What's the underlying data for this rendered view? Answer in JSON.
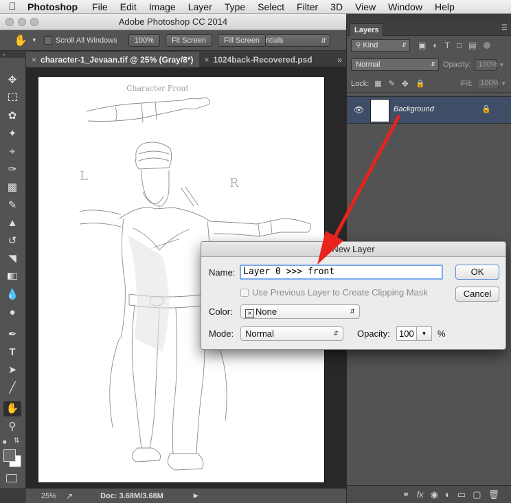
{
  "menubar": {
    "app_name": "Photoshop",
    "items": [
      "File",
      "Edit",
      "Image",
      "Layer",
      "Type",
      "Select",
      "Filter",
      "3D",
      "View",
      "Window",
      "Help"
    ]
  },
  "window": {
    "title": "Adobe Photoshop CC 2014"
  },
  "options_bar": {
    "scroll_all_label": "Scroll All Windows",
    "zoom_100_label": "100%",
    "fit_screen_label": "Fit Screen",
    "fill_screen_label": "Fill Screen",
    "workspace_label": "ntials"
  },
  "tabs": [
    {
      "label": "character-1_Jevaan.tif @ 25% (Gray/8*)",
      "close": "×",
      "active": true
    },
    {
      "label": "1024back-Recovered.psd",
      "close": "×",
      "active": false
    }
  ],
  "tabs_overflow": "»",
  "sketch_texts": {
    "title": "Character  Front",
    "left_mark": "L",
    "right_mark": "R"
  },
  "status": {
    "zoom": "25%",
    "doc": "Doc: 3.68M/3.68M",
    "arrow": "▶"
  },
  "layers_panel": {
    "tab_label": "Layers",
    "filter_label": "Kind",
    "blend_mode": "Normal",
    "opacity_label": "Opacity:",
    "opacity_value": "100%",
    "lock_label": "Lock:",
    "fill_label": "Fill:",
    "fill_value": "100%",
    "layer_name": "Background",
    "footer_icons": [
      "link-icon",
      "fx-icon",
      "mask-icon",
      "adjustment-icon",
      "folder-icon",
      "new-layer-icon",
      "trash-icon"
    ],
    "fx_glyph": "fx"
  },
  "dialog": {
    "title": "New Layer",
    "name_label": "Name:",
    "name_value": "Layer 0 >>> front",
    "clipping_label": "Use Previous Layer to Create Clipping Mask",
    "color_label": "Color:",
    "color_value": "None",
    "color_x": "×",
    "mode_label": "Mode:",
    "mode_value": "Normal",
    "opacity_label": "Opacity:",
    "opacity_value": "100",
    "opacity_unit": "%",
    "ok_label": "OK",
    "cancel_label": "Cancel"
  },
  "colors": {
    "annotation_arrow": "#e8231e",
    "selected_layer": "#3f4e66",
    "dialog_focus": "#7aaaf0"
  }
}
